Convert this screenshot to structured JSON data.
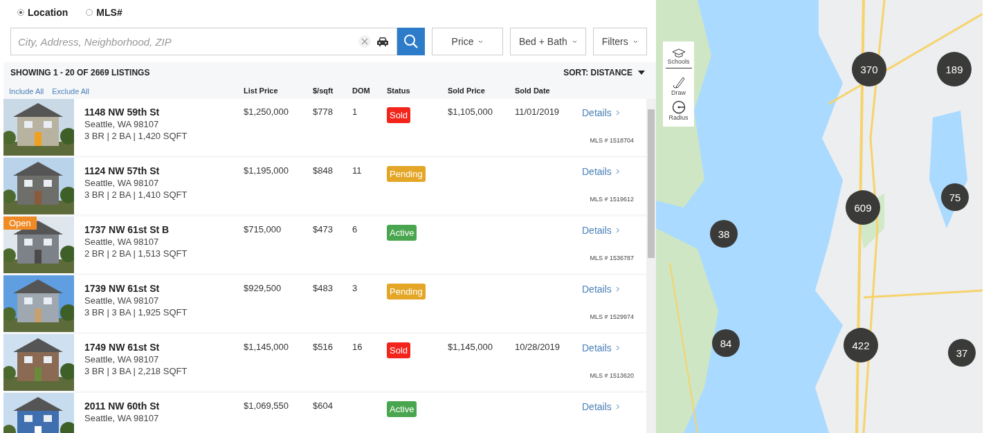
{
  "search_mode": [
    {
      "label": "Location",
      "selected": true
    },
    {
      "label": "MLS#",
      "selected": false
    }
  ],
  "search": {
    "placeholder": "City, Address, Neighborhood, ZIP"
  },
  "filters": [
    {
      "label": "Price"
    },
    {
      "label": "Bed + Bath"
    },
    {
      "label": "Filters"
    }
  ],
  "results": {
    "summary": "SHOWING 1 - 20 OF 2669 LISTINGS",
    "sort": "SORT: DISTANCE"
  },
  "bulk_actions": [
    "Include All",
    "Exclude All"
  ],
  "columns": [
    "List Price",
    "$/sqft",
    "DOM",
    "Status",
    "Sold Price",
    "Sold Date"
  ],
  "listings": [
    {
      "address": "1148 NW 59th St",
      "city": "Seattle, WA 98107",
      "specs": "3 BR | 2 BA | 1,420 SQFT",
      "list_price": "$1,250,000",
      "per_sqft": "$778",
      "dom": "1",
      "status": "Sold",
      "color": "#f3251b",
      "sold_price": "$1,105,000",
      "sold_date": "11/01/2019",
      "link": "Details",
      "mls": "MLS # 1518704"
    },
    {
      "address": "1124 NW 57th St",
      "city": "Seattle, WA 98107",
      "specs": "3 BR | 2 BA | 1,410 SQFT",
      "list_price": "$1,195,000",
      "per_sqft": "$848",
      "dom": "11",
      "status": "Pending",
      "color": "#e3a626",
      "link": "Details",
      "mls": "MLS # 1519612"
    },
    {
      "badge": "Open",
      "address": "1737 NW 61st St B",
      "city": "Seattle, WA 98107",
      "specs": "2 BR | 2 BA | 1,513 SQFT",
      "list_price": "$715,000",
      "per_sqft": "$473",
      "dom": "6",
      "status": "Active",
      "color": "#4aa64e",
      "link": "Details",
      "mls": "MLS # 1536787"
    },
    {
      "address": "1739 NW 61st St",
      "city": "Seattle, WA 98107",
      "specs": "3 BR | 3 BA | 1,925 SQFT",
      "list_price": "$929,500",
      "per_sqft": "$483",
      "dom": "3",
      "status": "Pending",
      "color": "#e3a626",
      "link": "Details",
      "mls": "MLS # 1529974"
    },
    {
      "address": "1749 NW 61st St",
      "city": "Seattle, WA 98107",
      "specs": "3 BR | 3 BA | 2,218 SQFT",
      "list_price": "$1,145,000",
      "per_sqft": "$516",
      "dom": "16",
      "status": "Sold",
      "color": "#f3251b",
      "sold_price": "$1,145,000",
      "sold_date": "10/28/2019",
      "link": "Details",
      "mls": "MLS # 1513620"
    },
    {
      "address": "2011 NW 60th St",
      "city": "Seattle, WA 98107",
      "list_price": "$1,069,550",
      "per_sqft": "$604",
      "status": "Active",
      "color": "#4aa64e",
      "link": "Details"
    }
  ],
  "map_tools": [
    {
      "label": "Schools",
      "kind": "schools"
    },
    {
      "label": "Draw",
      "kind": "draw"
    },
    {
      "label": "Radius",
      "kind": "radius"
    }
  ],
  "clusters": [
    {
      "count": "370"
    },
    {
      "count": "189"
    },
    {
      "count": "609"
    },
    {
      "count": "75"
    },
    {
      "count": "38"
    },
    {
      "count": "84"
    },
    {
      "count": "422"
    },
    {
      "count": "37"
    }
  ]
}
